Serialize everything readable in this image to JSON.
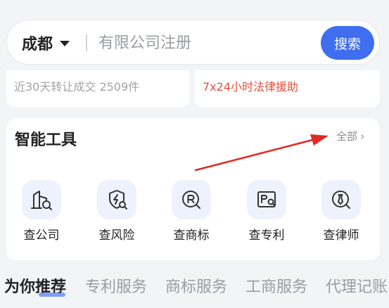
{
  "search": {
    "city": "成都",
    "placeholder": "有限公司注册",
    "button_label": "搜索"
  },
  "stats": {
    "left_text": "近30天转让成交 2509件",
    "right_text": "7x24小时法律援助"
  },
  "tools": {
    "title": "智能工具",
    "view_all_label": "全部",
    "items": [
      {
        "label": "查公司",
        "icon": "building-search-icon"
      },
      {
        "label": "查风险",
        "icon": "shield-lightning-search-icon"
      },
      {
        "label": "查商标",
        "icon": "registered-trademark-search-icon"
      },
      {
        "label": "查专利",
        "icon": "patent-document-search-icon"
      },
      {
        "label": "查律师",
        "icon": "lawyer-tie-search-icon"
      }
    ]
  },
  "tabs": [
    {
      "label": "为你推荐",
      "active": true
    },
    {
      "label": "专利服务"
    },
    {
      "label": "商标服务"
    },
    {
      "label": "工商服务"
    },
    {
      "label": "代理记账"
    }
  ],
  "colors": {
    "accent": "#3f6ef1",
    "highlight_red": "#e54f3c",
    "annotation_arrow": "#e02a23"
  }
}
